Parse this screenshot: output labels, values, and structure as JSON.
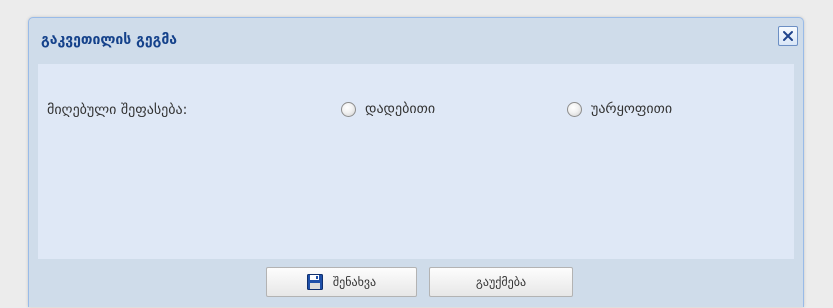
{
  "dialog": {
    "title": "გაკვეთილის გეგმა",
    "close_icon": "close-icon"
  },
  "form": {
    "field_label": "მიღებული შეფასება:",
    "options": [
      {
        "label": "დადებითი",
        "selected": false
      },
      {
        "label": "უარყოფითი",
        "selected": false
      }
    ]
  },
  "footer": {
    "save_label": "შენახვა",
    "save_icon": "floppy-disk-icon",
    "cancel_label": "გაუქმება"
  },
  "colors": {
    "title_text": "#15428b",
    "panel_bg": "#dfe8f6",
    "frame_bg": "#cfdcea",
    "border": "#99bbe8",
    "save_icon_blue": "#1e4fa8"
  }
}
